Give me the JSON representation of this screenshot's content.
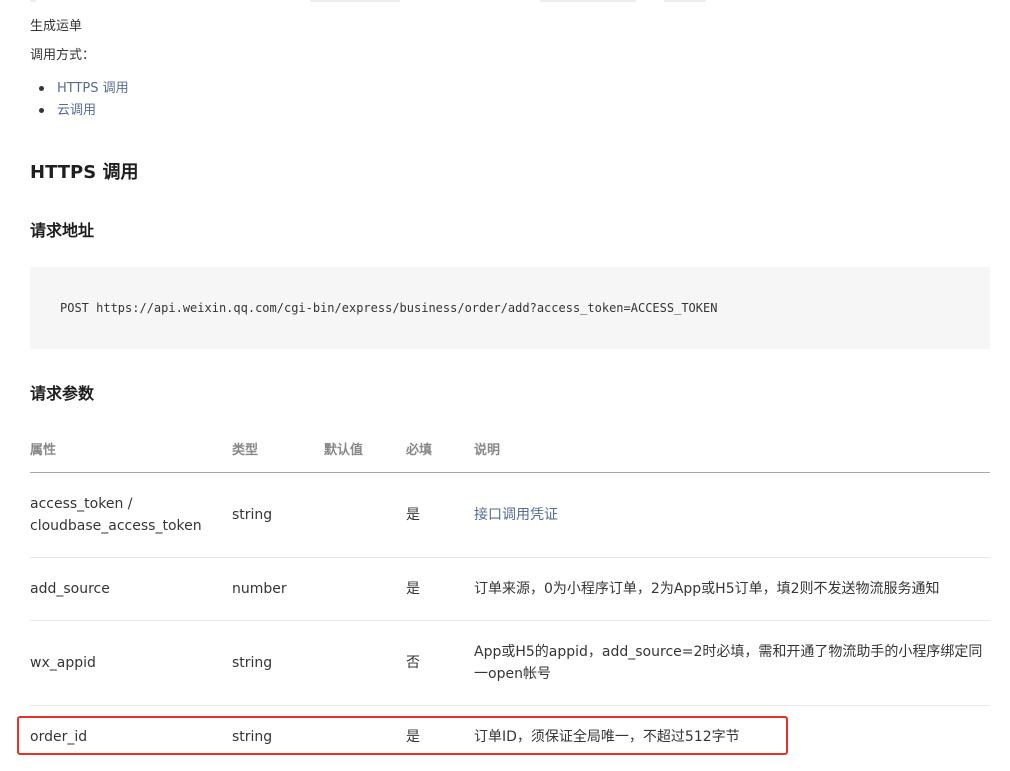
{
  "intro_title": "生成运单",
  "call_method_label": "调用方式：",
  "call_links": [
    "HTTPS 调用",
    "云调用"
  ],
  "section_title": "HTTPS 调用",
  "request_url": {
    "title": "请求地址",
    "code": "POST https://api.weixin.qq.com/cgi-bin/express/business/order/add?access_token=ACCESS_TOKEN"
  },
  "request_params": {
    "title": "请求参数",
    "headers": [
      "属性",
      "类型",
      "默认值",
      "必填",
      "说明"
    ],
    "rows": [
      {
        "name": "access_token / cloudbase_access_token",
        "type": "string",
        "default": "",
        "required": "是",
        "desc": "接口调用凭证",
        "desc_is_link": true
      },
      {
        "name": "add_source",
        "type": "number",
        "default": "",
        "required": "是",
        "desc": "订单来源，0为小程序订单，2为App或H5订单，填2则不发送物流服务通知",
        "desc_is_link": false
      },
      {
        "name": "wx_appid",
        "type": "string",
        "default": "",
        "required": "否",
        "desc": "App或H5的appid，add_source=2时必填，需和开通了物流助手的小程序绑定同一open帐号",
        "desc_is_link": false
      },
      {
        "name": "order_id",
        "type": "string",
        "default": "",
        "required": "是",
        "desc": "订单ID，须保证全局唯一，不超过512字节",
        "desc_is_link": false
      }
    ]
  },
  "colors": {
    "link": "#576b95",
    "highlight_border": "#e8302a",
    "code_bg": "#f6f6f6"
  }
}
